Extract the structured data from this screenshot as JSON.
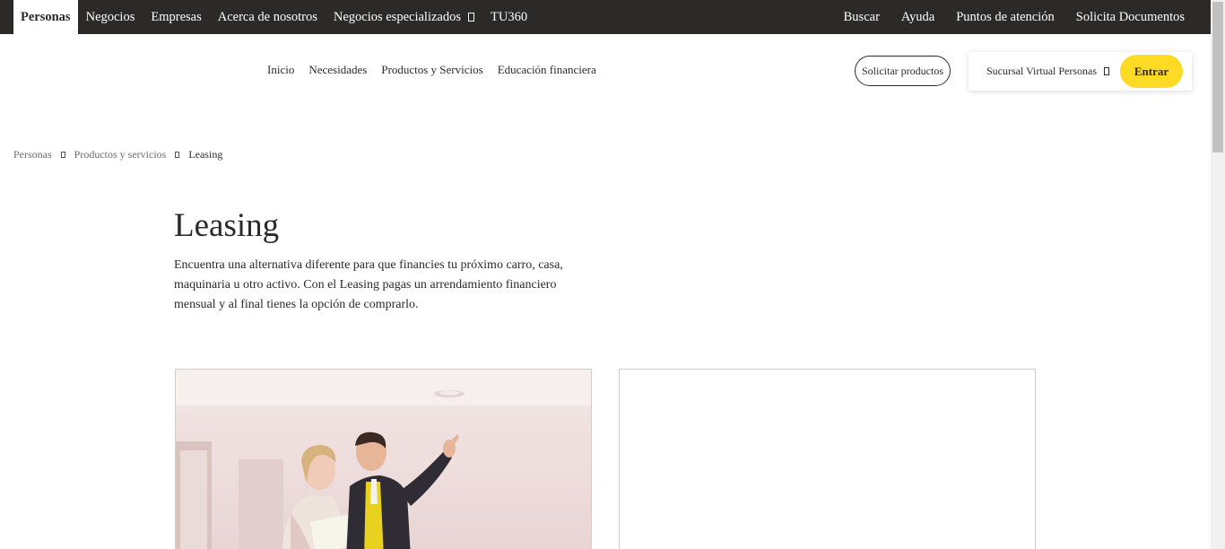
{
  "topnav": {
    "left": [
      "Personas",
      "Negocios",
      "Empresas",
      "Acerca de nosotros",
      "Negocios especializados",
      "TU360"
    ],
    "right": [
      "Buscar",
      "Ayuda",
      "Puntos de atención",
      "Solicita Documentos"
    ]
  },
  "mainnav": [
    "Inicio",
    "Necesidades",
    "Productos y Servicios",
    "Educación financiera"
  ],
  "actions": {
    "solicitar": "Solicitar productos",
    "sucursal": "Sucursal Virtual Personas",
    "entrar": "Entrar"
  },
  "breadcrumb": [
    "Personas",
    "Productos y servicios",
    "Leasing"
  ],
  "hero": {
    "title": "Leasing",
    "description": "Encuentra una alternativa diferente para que financies tu próximo carro, casa, maquinaria u otro activo. Con el Leasing pagas un arrendamiento financiero mensual y al final tienes la opción de comprarlo."
  },
  "colors": {
    "brand_yellow": "#fdda24",
    "dark": "#2c2a29"
  },
  "icons": {
    "dropdown": "chevron-down-icon",
    "breadcrumb_separator": "chevron-right-icon"
  }
}
